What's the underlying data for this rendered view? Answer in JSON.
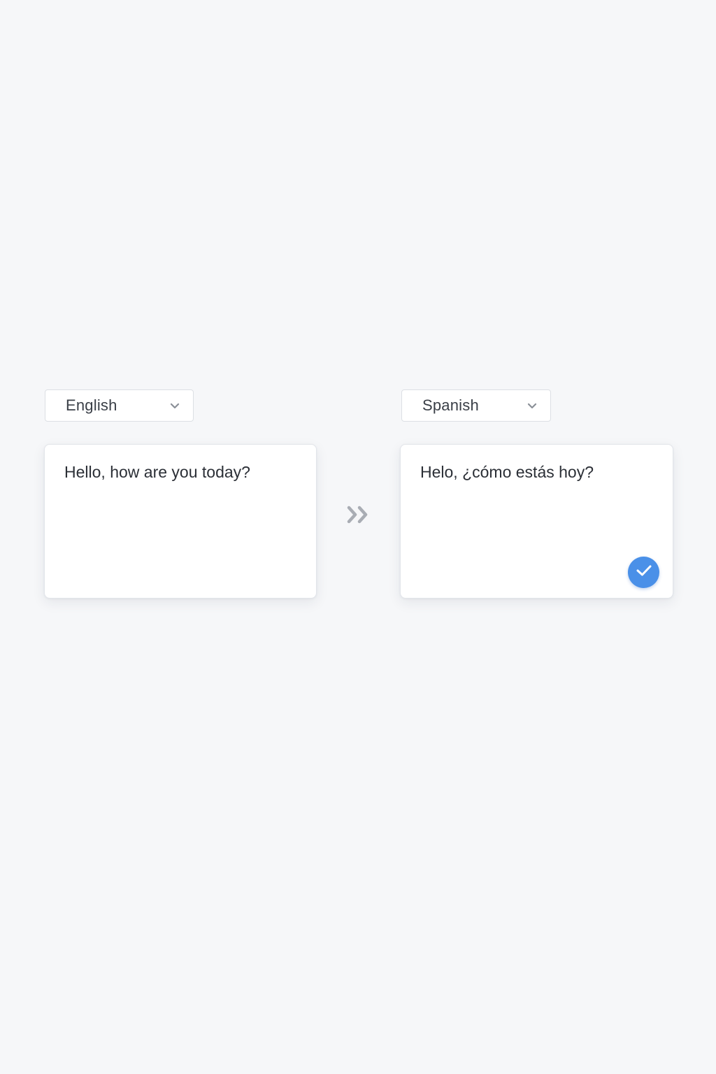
{
  "source": {
    "language": "English",
    "text": "Hello, how are you today?"
  },
  "target": {
    "language": "Spanish",
    "text": "Helo, ¿cómo estás hoy?"
  },
  "icons": {
    "source_dropdown": "chevron-down-icon",
    "target_dropdown": "chevron-down-icon",
    "translate_direction": "double-chevron-right-icon",
    "status": "checkmark-icon"
  },
  "colors": {
    "background": "#f6f7f9",
    "accent": "#4a90e8",
    "arrow": "#a9adb4"
  }
}
